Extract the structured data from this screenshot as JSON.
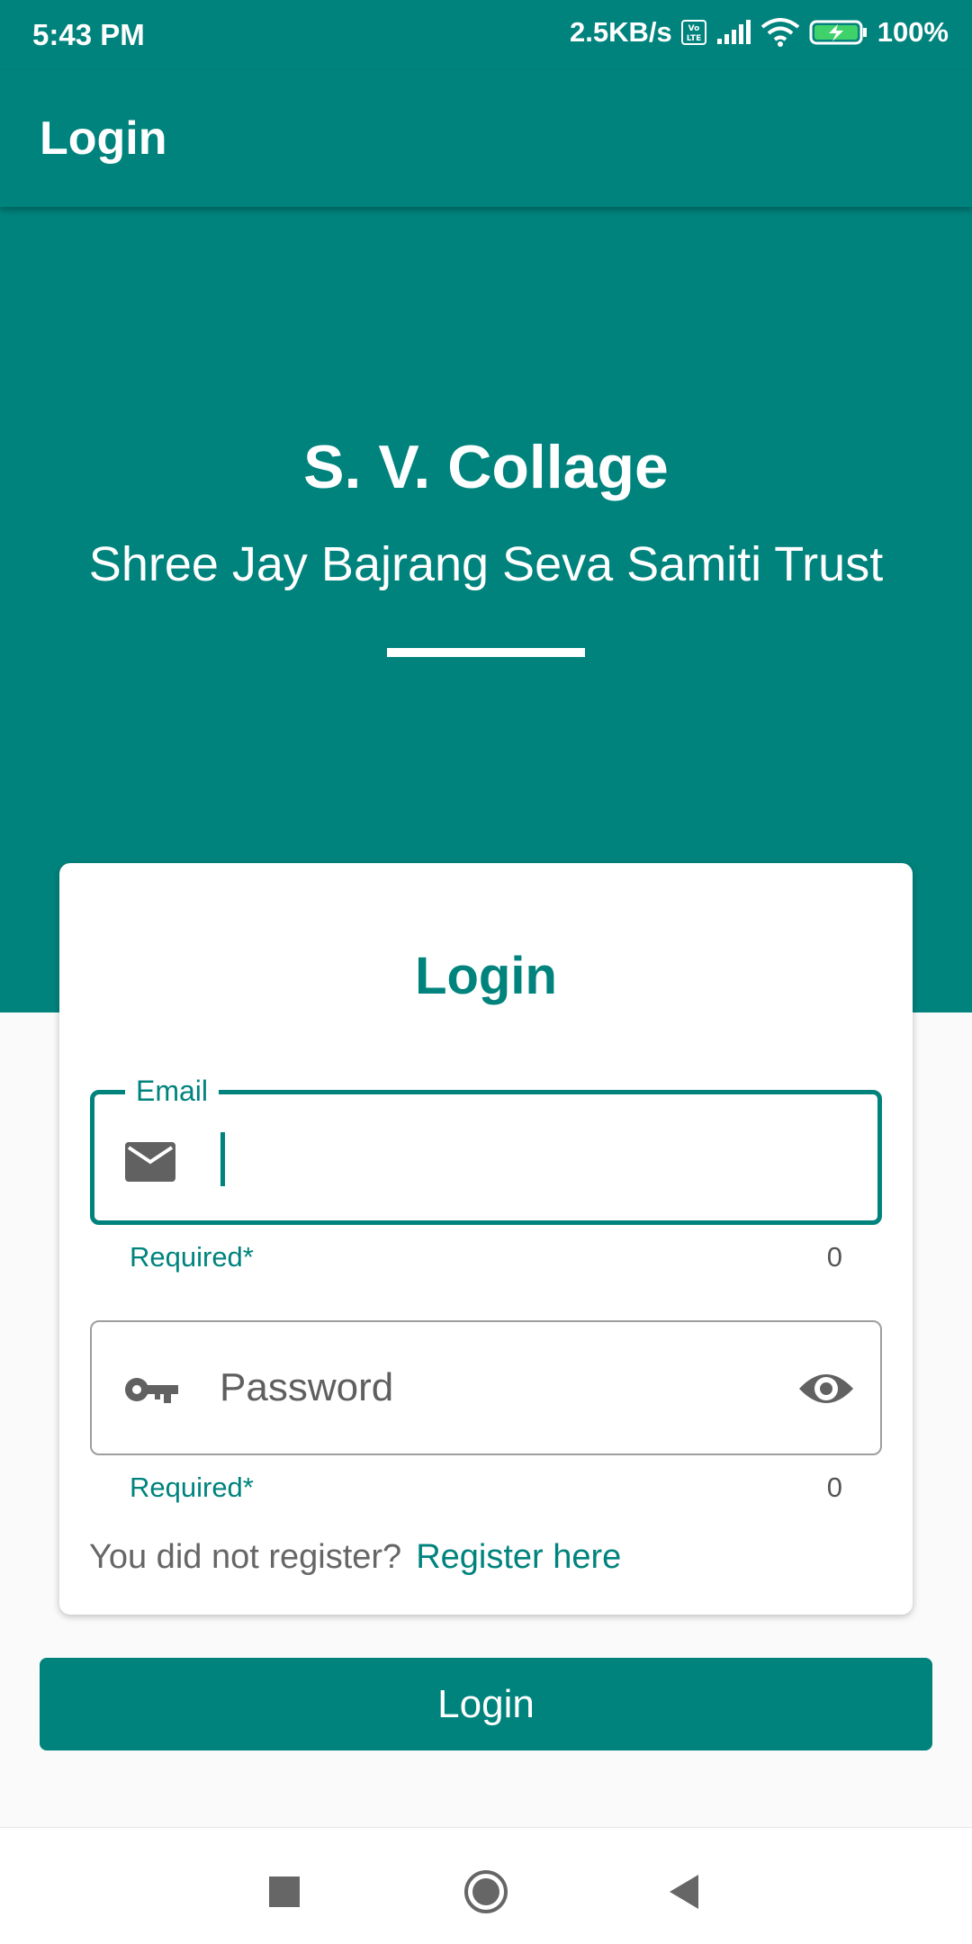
{
  "status_bar": {
    "time": "5:43 PM",
    "net_speed": "2.5KB/s",
    "volte": "Vo LTE",
    "battery": "100%"
  },
  "app_bar": {
    "title": "Login"
  },
  "hero": {
    "title": "S. V. Collage",
    "subtitle": "Shree Jay Bajrang Seva Samiti Trust"
  },
  "card": {
    "title": "Login",
    "email": {
      "label": "Email",
      "value": "",
      "helper": "Required*",
      "counter": "0",
      "icon": "mail-icon"
    },
    "password": {
      "placeholder": "Password",
      "value": "",
      "helper": "Required*",
      "counter": "0",
      "icon": "key-icon",
      "toggle_icon": "eye-icon"
    },
    "register_prompt": "You did not register?",
    "register_link": "Register here"
  },
  "login_button": "Login",
  "nav_bar": {
    "icons": [
      "recents-icon",
      "home-icon",
      "back-icon"
    ]
  },
  "colors": {
    "primary": "#00837d",
    "background": "#fafafa"
  }
}
